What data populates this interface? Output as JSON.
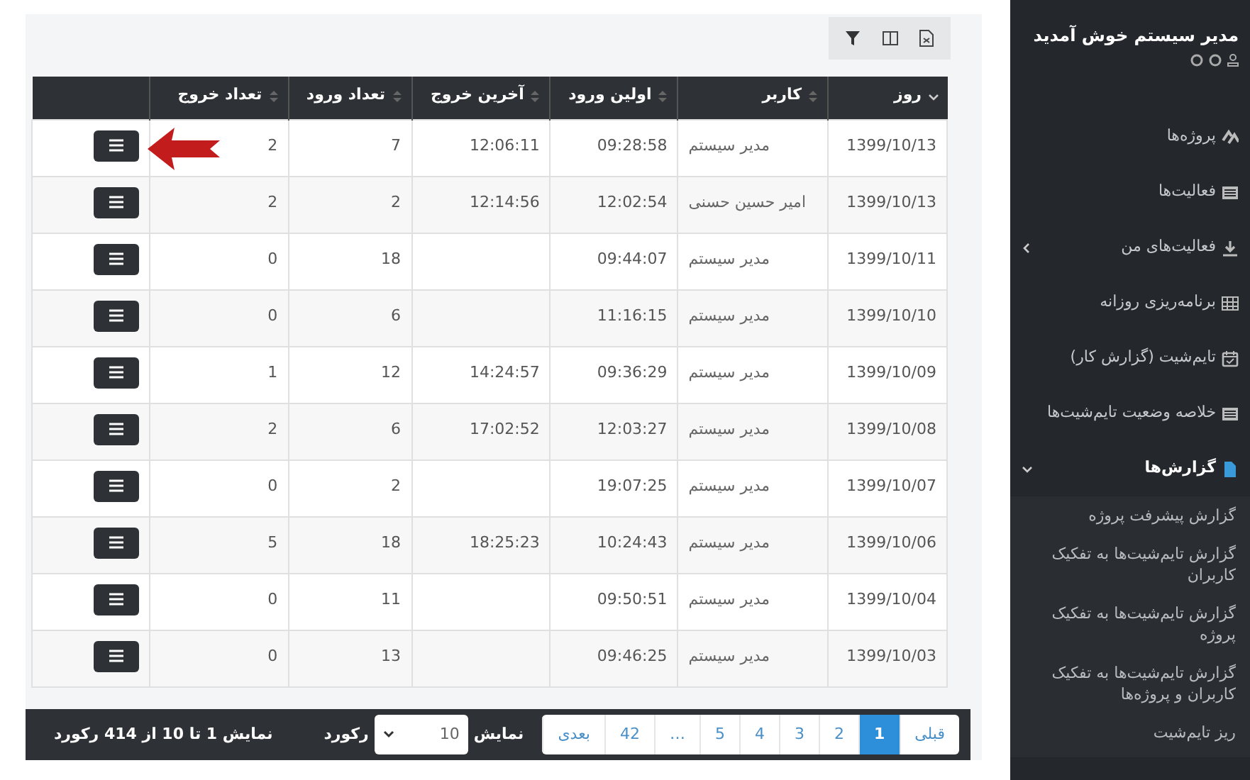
{
  "sidebar": {
    "welcome": "مدیر سیستم خوش آمدید",
    "items": [
      {
        "label": "پروژه‌ها",
        "selected": false
      },
      {
        "label": "فعالیت‌ها",
        "selected": false
      },
      {
        "label": "فعالیت‌های من",
        "expanded": false,
        "selected": false
      },
      {
        "label": "برنامه‌ریزی روزانه",
        "selected": false
      },
      {
        "label": "تایم‌شیت (گزارش کار)",
        "selected": false
      },
      {
        "label": "خلاصه وضعیت تایم‌شیت‌ها",
        "selected": false
      },
      {
        "label": "گزارش‌ها",
        "expanded": true,
        "selected": true,
        "children": [
          {
            "label": "گزارش پیشرفت پروژه"
          },
          {
            "label": "گزارش تایم‌شیت‌ها به تفکیک کاربران"
          },
          {
            "label": "گزارش تایم‌شیت‌ها به تفکیک پروژه"
          },
          {
            "label": "گزارش تایم‌شیت‌ها به تفکیک کاربران و پروژه‌ها"
          },
          {
            "label": "ریز تایم‌شیت"
          }
        ]
      }
    ]
  },
  "table": {
    "columns": [
      {
        "label": "روز",
        "sorted": true
      },
      {
        "label": "کاربر",
        "sorted": false
      },
      {
        "label": "اولین ورود",
        "sorted": false
      },
      {
        "label": "آخرین خروج",
        "sorted": false
      },
      {
        "label": "تعداد ورود",
        "sorted": false
      },
      {
        "label": "تعداد خروج",
        "sorted": false
      }
    ],
    "rows": [
      {
        "cells": [
          "1399/10/13",
          "مدیر سیستم",
          "09:28:58",
          "12:06:11",
          "7",
          "2"
        ],
        "pointed": true
      },
      {
        "cells": [
          "1399/10/13",
          "امیر حسین حسنی",
          "12:02:54",
          "12:14:56",
          "2",
          "2"
        ],
        "pointed": false
      },
      {
        "cells": [
          "1399/10/11",
          "مدیر سیستم",
          "09:44:07",
          "",
          "18",
          "0"
        ],
        "pointed": false
      },
      {
        "cells": [
          "1399/10/10",
          "مدیر سیستم",
          "11:16:15",
          "",
          "6",
          "0"
        ],
        "pointed": false
      },
      {
        "cells": [
          "1399/10/09",
          "مدیر سیستم",
          "09:36:29",
          "14:24:57",
          "12",
          "1"
        ],
        "pointed": false
      },
      {
        "cells": [
          "1399/10/08",
          "مدیر سیستم",
          "12:03:27",
          "17:02:52",
          "6",
          "2"
        ],
        "pointed": false
      },
      {
        "cells": [
          "1399/10/07",
          "مدیر سیستم",
          "19:07:25",
          "",
          "2",
          "0"
        ],
        "pointed": false
      },
      {
        "cells": [
          "1399/10/06",
          "مدیر سیستم",
          "10:24:43",
          "18:25:23",
          "18",
          "5"
        ],
        "pointed": false
      },
      {
        "cells": [
          "1399/10/04",
          "مدیر سیستم",
          "09:50:51",
          "",
          "11",
          "0"
        ],
        "pointed": false
      },
      {
        "cells": [
          "1399/10/03",
          "مدیر سیستم",
          "09:46:25",
          "",
          "13",
          "0"
        ],
        "pointed": false
      }
    ]
  },
  "pagination": {
    "pages": [
      {
        "label": "قبلی",
        "selected": false
      },
      {
        "label": "1",
        "selected": true
      },
      {
        "label": "2",
        "selected": false
      },
      {
        "label": "3",
        "selected": false
      },
      {
        "label": "4",
        "selected": false
      },
      {
        "label": "5",
        "selected": false
      },
      {
        "label": "…",
        "selected": false
      },
      {
        "label": "42",
        "selected": false
      },
      {
        "label": "بعدی",
        "selected": false
      }
    ],
    "show_label": "نمایش",
    "page_size": "10",
    "records_label": "رکورد",
    "info": "نمایش 1 تا 10 از 414 رکورد"
  }
}
